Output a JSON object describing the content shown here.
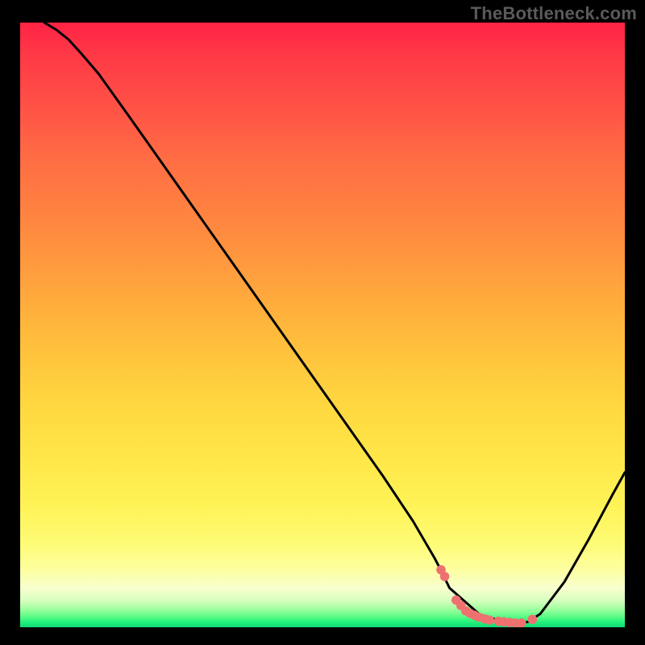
{
  "watermark": "TheBottleneck.com",
  "chart_data": {
    "type": "line",
    "title": "",
    "xlabel": "",
    "ylabel": "",
    "xlim": [
      0,
      100
    ],
    "ylim": [
      0,
      100
    ],
    "grid": false,
    "series": [
      {
        "name": "curve",
        "color": "#000000",
        "x": [
          4,
          6,
          8,
          10,
          13,
          18,
          24,
          30,
          36,
          42,
          48,
          54,
          60,
          65,
          68.5,
          69.5,
          71,
          76,
          80,
          82,
          83,
          84,
          86,
          90,
          94,
          98,
          100
        ],
        "y": [
          100,
          98.8,
          97.2,
          95,
          91.5,
          84.5,
          76,
          67.5,
          59,
          50.5,
          42,
          33.5,
          25,
          17.5,
          11.5,
          9.6,
          6.5,
          2.1,
          0.9,
          0.7,
          0.7,
          0.9,
          2.2,
          7.5,
          14.5,
          22,
          25.6
        ]
      },
      {
        "name": "highlight-dots",
        "color": "#ee7170",
        "x": [
          69.6,
          70.2,
          72.1,
          72.9,
          73.7,
          74.4,
          75.1,
          75.8,
          76.8,
          77.6,
          79.1,
          80.0,
          81.0,
          81.9,
          82.9,
          84.7
        ],
        "y": [
          9.5,
          8.4,
          4.5,
          3.6,
          2.7,
          2.3,
          2.0,
          1.7,
          1.4,
          1.2,
          1.0,
          0.9,
          0.8,
          0.7,
          0.7,
          1.3
        ]
      }
    ],
    "background_gradient": {
      "orientation": "vertical",
      "stops": [
        {
          "pos": 0.0,
          "color": "#ff2345"
        },
        {
          "pos": 0.32,
          "color": "#ff8440"
        },
        {
          "pos": 0.64,
          "color": "#ffd940"
        },
        {
          "pos": 0.86,
          "color": "#fefb74"
        },
        {
          "pos": 0.955,
          "color": "#d8ffbf"
        },
        {
          "pos": 1.0,
          "color": "#0fd877"
        }
      ]
    }
  }
}
